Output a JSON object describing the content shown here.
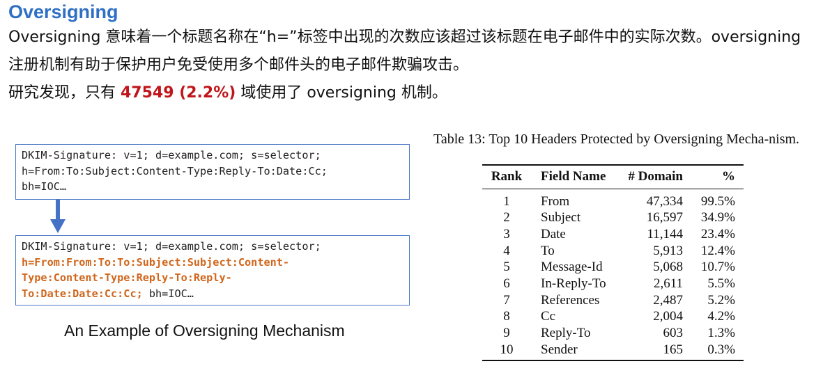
{
  "heading": "Oversigning",
  "paragraph1": "Oversigning 意味着一个标题名称在“h=”标签中出现的次数应该超过该标题在电子邮件中的实际次数。oversigning 注册机制有助于保护用户免受使用多个邮件头的电子邮件欺骗攻击。",
  "paragraph2": {
    "before": "研究发现，只有 ",
    "highlight": "47549 (2.2%)",
    "after": " 域使用了 oversigning  机制。"
  },
  "example_before": {
    "line1": "DKIM-Signature: v=1; d=example.com; s=selector;",
    "line2": "h=From:To:Subject:Content-Type:Reply-To:Date:Cc;",
    "line3": "bh=IOC…"
  },
  "example_after": {
    "line1": "DKIM-Signature: v=1; d=example.com; s=selector;",
    "line2": "h=From:From:To:To:Subject:Subject:Content-",
    "line3": "Type:Content-Type:Reply-To:Reply-",
    "line4_highlight": "To:Date:Date:Cc:Cc;",
    "line4_rest": " bh=IOC…"
  },
  "example_caption": "An Example of Oversigning Mechanism",
  "table": {
    "caption": "Table 13:  Top 10 Headers Protected by Oversigning Mecha-nism.",
    "headers": [
      "Rank",
      "Field Name",
      "# Domain",
      "%"
    ],
    "rows": [
      [
        "1",
        "From",
        "47,334",
        "99.5%"
      ],
      [
        "2",
        "Subject",
        "16,597",
        "34.9%"
      ],
      [
        "3",
        "Date",
        "11,144",
        "23.4%"
      ],
      [
        "4",
        "To",
        "5,913",
        "12.4%"
      ],
      [
        "5",
        "Message-Id",
        "5,068",
        "10.7%"
      ],
      [
        "6",
        "In-Reply-To",
        "2,611",
        "5.5%"
      ],
      [
        "7",
        "References",
        "2,487",
        "5.2%"
      ],
      [
        "8",
        "Cc",
        "2,004",
        "4.2%"
      ],
      [
        "9",
        "Reply-To",
        "603",
        "1.3%"
      ],
      [
        "10",
        "Sender",
        "165",
        "0.3%"
      ]
    ]
  },
  "colors": {
    "heading": "#2f6fc4",
    "highlight": "#c0161b",
    "oversign_fields": "#d0661c",
    "box_border": "#4a78c4",
    "arrow": "#4472c4"
  }
}
